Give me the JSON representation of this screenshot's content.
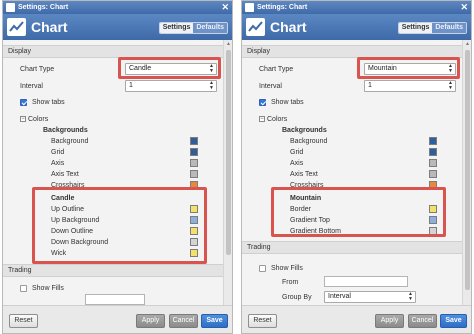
{
  "colors": {
    "accent": "#4a78b9",
    "highlight": "#d9534f",
    "save_button": "#2f70c8",
    "swatch_blue": "#2f5f9a",
    "swatch_gray": "#b9b9b9",
    "swatch_orange": "#e7893a",
    "swatch_yellow": "#f2e26a",
    "swatch_light_blue": "#8bb0de",
    "swatch_light_gray": "#d4d4d4"
  },
  "left": {
    "window_title": "Settings: Chart",
    "header_title": "Chart",
    "tabs": [
      "Settings",
      "Defaults"
    ],
    "display_section": "Display",
    "chart_type_label": "Chart Type",
    "chart_type_value": "Candle",
    "interval_label": "Interval",
    "interval_value": "1",
    "show_tabs_label": "Show tabs",
    "colors_label": "Colors",
    "backgrounds_header": "Backgrounds",
    "background_items": [
      "Background",
      "Grid",
      "Axis",
      "Axis Text",
      "Crosshairs"
    ],
    "candle_header": "Candle",
    "candle_items": [
      "Up Outline",
      "Up Background",
      "Down Outline",
      "Down Background",
      "Wick"
    ],
    "trading_section": "Trading",
    "show_fills_label": "Show Fills",
    "buttons": {
      "reset": "Reset",
      "apply": "Apply",
      "cancel": "Cancel",
      "save": "Save"
    }
  },
  "right": {
    "window_title": "Settings: Chart",
    "header_title": "Chart",
    "tabs": [
      "Settings",
      "Defaults"
    ],
    "display_section": "Display",
    "chart_type_label": "Chart Type",
    "chart_type_value": "Mountain",
    "interval_label": "Interval",
    "interval_value": "1",
    "show_tabs_label": "Show tabs",
    "colors_label": "Colors",
    "backgrounds_header": "Backgrounds",
    "background_items": [
      "Background",
      "Grid",
      "Axis",
      "Axis Text",
      "Crosshairs"
    ],
    "mountain_header": "Mountain",
    "mountain_items": [
      "Border",
      "Gradient Top",
      "Gradient Bottom"
    ],
    "trading_section": "Trading",
    "show_fills_label": "Show Fills",
    "from_label": "From",
    "group_by_label": "Group By",
    "group_by_value": "Interval",
    "buttons": {
      "reset": "Reset",
      "apply": "Apply",
      "cancel": "Cancel",
      "save": "Save"
    }
  }
}
